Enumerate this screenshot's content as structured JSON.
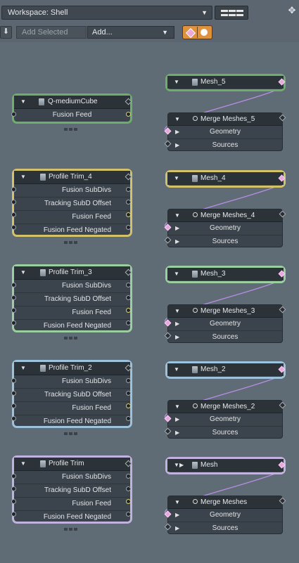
{
  "toolbar": {
    "workspace_label": "Workspace: Shell",
    "add_selected_placeholder": "Add Selected",
    "add_menu_label": "Add..."
  },
  "groups": [
    {
      "color": "#6fae6a",
      "input_node": {
        "title": "Q-mediumCube",
        "rows": [
          "Fusion Feed"
        ]
      },
      "mesh_node": {
        "title": "Mesh_5"
      },
      "merge": {
        "title": "Merge Meshes_5",
        "rows": [
          "Geometry",
          "Sources"
        ]
      }
    },
    {
      "color": "#d4c26a",
      "input_node": {
        "title": "Profile Trim_4",
        "rows": [
          "Fusion SubDivs",
          "Tracking SubD Offset",
          "Fusion Feed",
          "Fusion Feed Negated"
        ]
      },
      "mesh_node": {
        "title": "Mesh_4"
      },
      "merge": {
        "title": "Merge Meshes_4",
        "rows": [
          "Geometry",
          "Sources"
        ]
      }
    },
    {
      "color": "#9ccfa0",
      "input_node": {
        "title": "Profile Trim_3",
        "rows": [
          "Fusion SubDivs",
          "Tracking SubD Offset",
          "Fusion Feed",
          "Fusion Feed Negated"
        ]
      },
      "mesh_node": {
        "title": "Mesh_3"
      },
      "merge": {
        "title": "Merge Meshes_3",
        "rows": [
          "Geometry",
          "Sources"
        ]
      }
    },
    {
      "color": "#9dc2de",
      "input_node": {
        "title": "Profile Trim_2",
        "rows": [
          "Fusion SubDivs",
          "Tracking SubD Offset",
          "Fusion Feed",
          "Fusion Feed Negated"
        ]
      },
      "mesh_node": {
        "title": "Mesh_2"
      },
      "merge": {
        "title": "Merge Meshes_2",
        "rows": [
          "Geometry",
          "Sources"
        ]
      }
    },
    {
      "color": "#c2b2df",
      "input_node": {
        "title": "Profile Trim",
        "rows": [
          "Fusion SubDivs",
          "Tracking SubD Offset",
          "Fusion Feed",
          "Fusion Feed Negated"
        ]
      },
      "mesh_node": {
        "title": "Mesh"
      },
      "merge": {
        "title": "Merge Meshes",
        "rows": [
          "Geometry",
          "Sources"
        ]
      }
    }
  ],
  "wire_color": "#b98ee6",
  "icons": [
    "chevron-down-icon",
    "layout-grid-icon",
    "move-icon",
    "down-arrow-icon",
    "diamond-mode-icon",
    "circle-mode-icon",
    "collapse-triangle-icon",
    "cube-icon",
    "gear-icon",
    "play-icon"
  ]
}
